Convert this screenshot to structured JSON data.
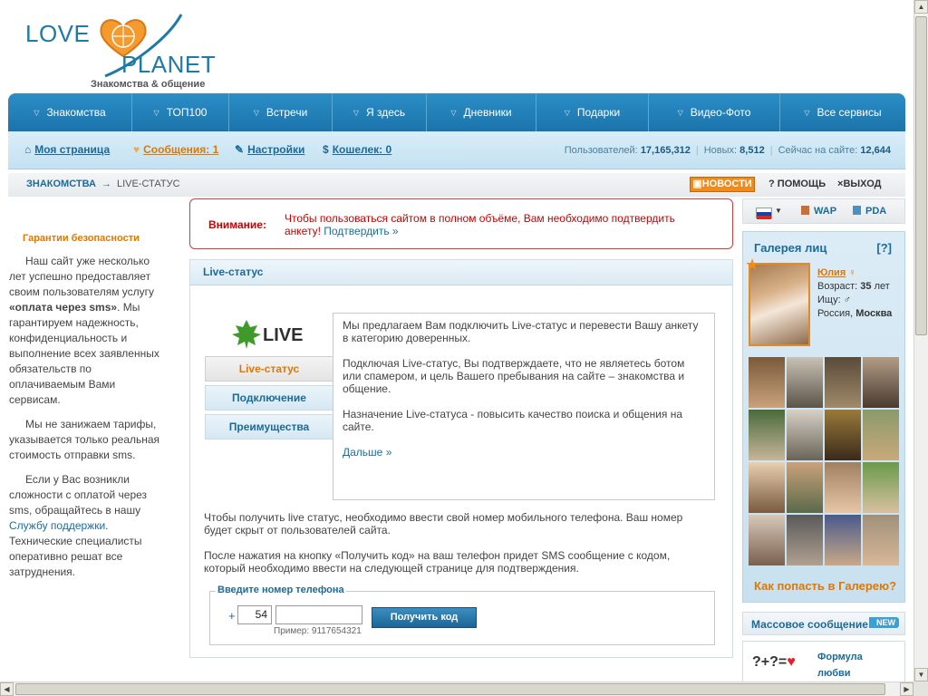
{
  "logo": {
    "love": "LOVE",
    "planet": "PLANET",
    "tagline": "Знакомства & общение"
  },
  "nav": [
    "Знакомства",
    "ТОП100",
    "Встречи",
    "Я здесь",
    "Дневники",
    "Подарки",
    "Видео-Фото",
    "Все сервисы"
  ],
  "subnav": {
    "my_page": "Моя страница",
    "messages": "Сообщения: 1",
    "settings": "Настройки",
    "wallet": "Кошелек: 0",
    "users_label": "Пользователей:",
    "users": "17,165,312",
    "new_label": "Новых:",
    "new": "8,512",
    "online_label": "Сейчас на сайте:",
    "online": "12,644"
  },
  "breadcrumb": {
    "root": "ЗНАКОМСТВА",
    "arrow": "→",
    "current": "LIVE-СТАТУС"
  },
  "top_actions": {
    "news": "НОВОСТИ",
    "help": "ПОМОЩЬ",
    "exit": "ВЫХОД",
    "help_mark": "?",
    "exit_mark": "×"
  },
  "left": {
    "title": "Гарантии безопасности",
    "p1_a": "Наш сайт уже несколько лет успешно предоставляет своим пользователям услугу ",
    "p1_b": "«оплата через sms»",
    "p1_c": ". Мы гарантируем надежность, конфиденциальность и выполнение всех заявленных обязательств по оплачиваемым Вами сервисам.",
    "p2": "Мы не занижаем тарифы, указывается только реальная стоимость отправки sms.",
    "p3_a": "Если у Вас возникли сложности с оплатой через sms, обращайтесь в нашу ",
    "p3_link": "Службу поддержки",
    "p3_b": ". Технические специалисты оперативно решат все затруднения."
  },
  "alert": {
    "title": "Внимание:",
    "text": "Чтобы пользоваться сайтом в полном объёме, Вам необходимо подтвердить анкету! ",
    "link": "Подтвердить »"
  },
  "panel": {
    "header": "Live-статус",
    "logo_text": "LIVE",
    "tabs": [
      "Live-статус",
      "Подключение",
      "Преимущества"
    ],
    "info": [
      "Мы предлагаем Вам подключить Live-статус и перевести Вашу анкету в категорию доверенных.",
      "Подключая Live-статус, Вы подтверждаете, что не являетесь ботом или спамером, и цель Вашего пребывания на сайте – знакомства и общение.",
      "Назначение Live-статуса - повысить качество поиска и общения на сайте."
    ],
    "more": "Дальше »",
    "para1": "Чтобы получить live статус, необходимо ввести свой номер мобильного телефона. Ваш номер будет скрыт от пользователей сайта.",
    "para2": "После нажатия на кнопку «Получить код» на ваш телефон придет SMS сообщение с кодом, который необходимо ввести на следующей странице для подтверждения.",
    "phone_legend": "Введите номер телефона",
    "plus": "+",
    "code": "54",
    "hint": "Пример: 9117654321",
    "button": "Получить код"
  },
  "right": {
    "wap": "WAP",
    "pda": "PDA",
    "gallery_title": "Галерея лиц",
    "gallery_help": "[?]",
    "featured_name": "Юлия",
    "age_label": "Возраст:",
    "age": "35",
    "age_unit": "лет",
    "seek_label": "Ищу:",
    "country": "Россия,",
    "city": "Москва",
    "how": "Как попасть в Галерею?",
    "mass": "Массовое сообщение",
    "new_badge": "NEW",
    "formula_symbols": "?+?=",
    "formula_line1": "Формула",
    "formula_line2": "любви"
  },
  "colors": {
    "accent": "#1c73ab",
    "orange": "#e07800",
    "alert": "#cc0000"
  }
}
